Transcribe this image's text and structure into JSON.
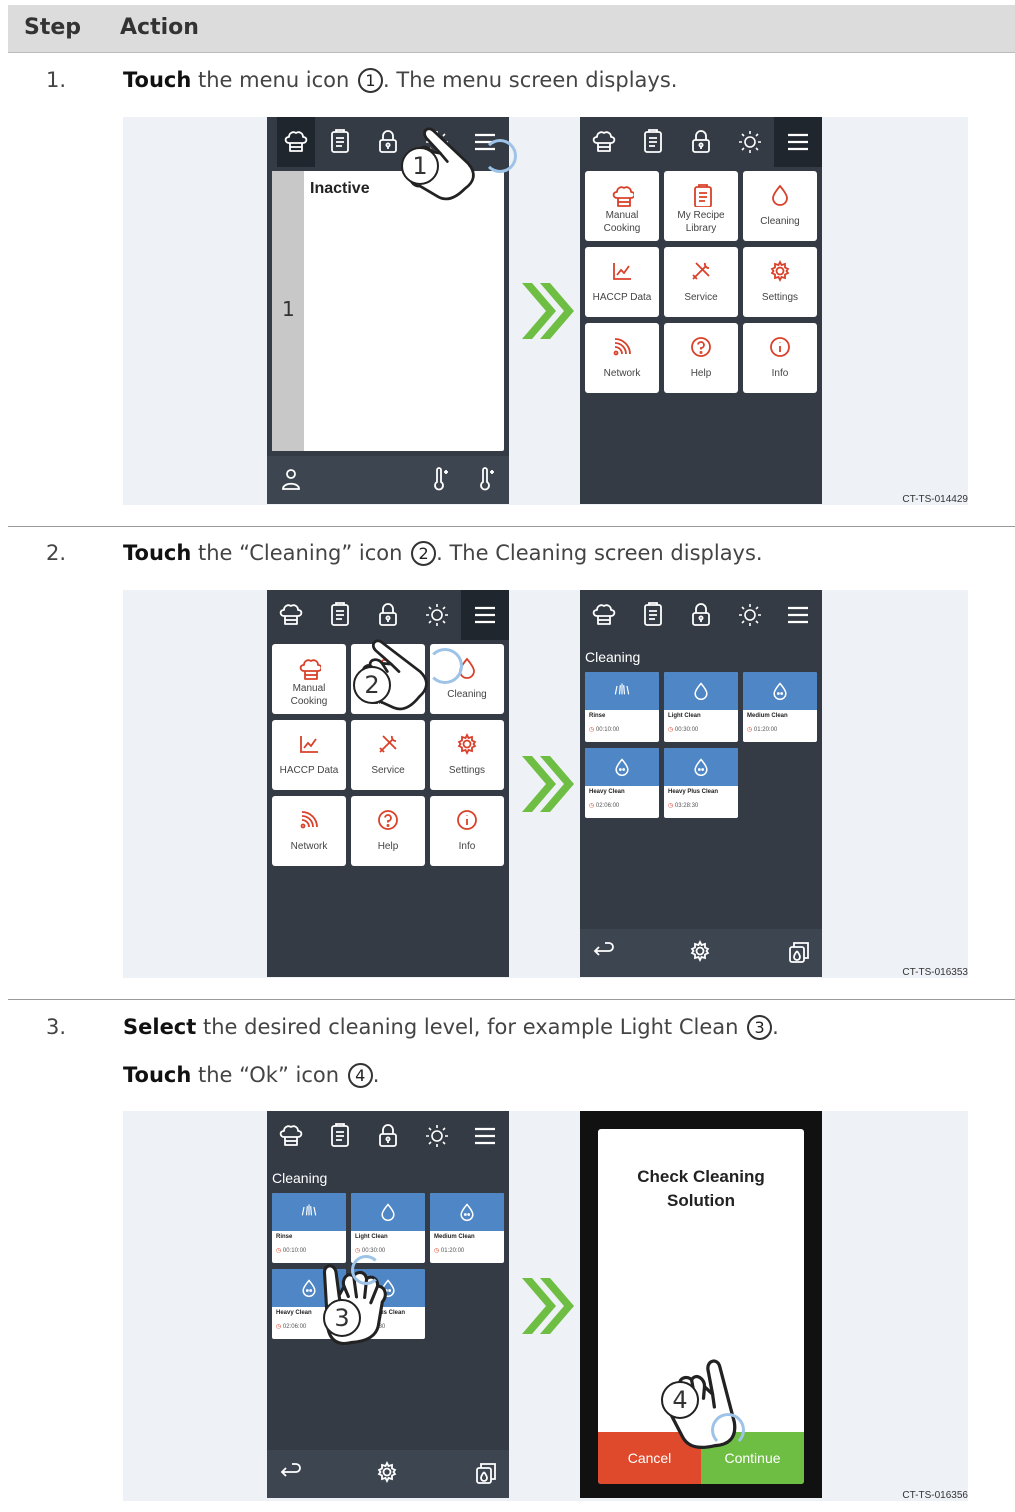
{
  "header": {
    "step": "Step",
    "action": "Action"
  },
  "steps": [
    {
      "num": "1.",
      "verb": "Touch",
      "text_a": " the menu icon ",
      "callout": "1",
      "text_b": ". The menu screen displays.",
      "code": "CT-TS-014429"
    },
    {
      "num": "2.",
      "verb": "Touch",
      "text_a": " the “Cleaning” icon ",
      "callout": "2",
      "text_b": ". The Cleaning screen displays.",
      "code": "CT-TS-016353"
    },
    {
      "num": "3.",
      "verb": "Select",
      "text_a": " the desired cleaning level, for example Light Clean ",
      "callout": "3",
      "text_b": ".",
      "verb2": "Touch",
      "text_c": " the “Ok” icon ",
      "callout2": "4",
      "text_d": ".",
      "code": "CT-TS-016356"
    }
  ],
  "idle_screen": {
    "status": "Inactive",
    "slot": "1"
  },
  "menu_tiles": [
    {
      "label": "Manual\nCooking",
      "icon": "chef-hat-icon"
    },
    {
      "label": "My Recipe\nLibrary",
      "icon": "recipe-icon"
    },
    {
      "label": "Cleaning",
      "icon": "drop-icon"
    },
    {
      "label": "HACCP Data",
      "icon": "chart-icon"
    },
    {
      "label": "Service",
      "icon": "tools-icon"
    },
    {
      "label": "Settings",
      "icon": "gear-icon"
    },
    {
      "label": "Network",
      "icon": "wifi-icon"
    },
    {
      "label": "Help",
      "icon": "help-icon"
    },
    {
      "label": "Info",
      "icon": "info-icon"
    }
  ],
  "cleaning_screen": {
    "title": "Cleaning",
    "programs": [
      {
        "name": "Rinse",
        "time": "00:10:00"
      },
      {
        "name": "Light Clean",
        "time": "00:30:00"
      },
      {
        "name": "Medium Clean",
        "time": "01:20:00"
      },
      {
        "name": "Heavy Clean",
        "time": "02:06:00"
      },
      {
        "name": "Heavy Plus Clean",
        "time": "03:28:30"
      }
    ]
  },
  "dialog": {
    "title_line1": "Check Cleaning",
    "title_line2": "Solution",
    "cancel": "Cancel",
    "continue": "Continue"
  },
  "colors": {
    "accent_green": "#6fbe44",
    "tile_blue": "#4f86c6",
    "cancel_red": "#e04a2c",
    "screen_dark": "#343b45"
  }
}
